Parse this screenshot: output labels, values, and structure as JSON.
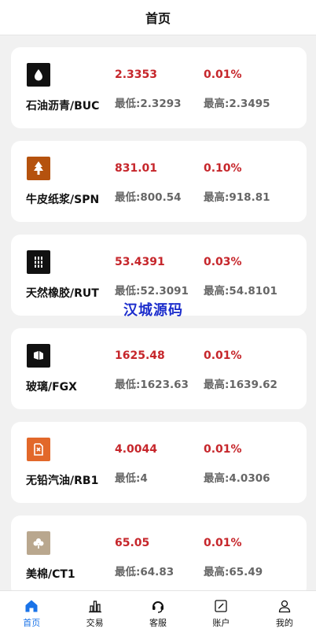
{
  "header": {
    "title": "首页"
  },
  "watermark": "汉城源码",
  "colors": {
    "up": "#c6262b",
    "accent": "#1a73e8"
  },
  "items": [
    {
      "name": "石油沥青/BUC",
      "price": "2.3353",
      "change": "0.01%",
      "low": "最低:2.3293",
      "high": "最高:2.3495",
      "icon": "drop-icon",
      "icon_color": "#111111"
    },
    {
      "name": "牛皮纸浆/SPN",
      "price": "831.01",
      "change": "0.10%",
      "low": "最低:800.54",
      "high": "最高:918.81",
      "icon": "tree-icon",
      "icon_color": "#b5520e"
    },
    {
      "name": "天然橡胶/RUT",
      "price": "53.4391",
      "change": "0.03%",
      "low": "最低:52.3091",
      "high": "最高:54.8101",
      "icon": "rubber-icon",
      "icon_color": "#111111"
    },
    {
      "name": "玻璃/FGX",
      "price": "1625.48",
      "change": "0.01%",
      "low": "最低:1623.63",
      "high": "最高:1639.62",
      "icon": "glass-icon",
      "icon_color": "#111111"
    },
    {
      "name": "无铅汽油/RB1",
      "price": "4.0044",
      "change": "0.01%",
      "low": "最低:4",
      "high": "最高:4.0306",
      "icon": "fuel-can-icon",
      "icon_color": "#e2682a"
    },
    {
      "name": "美棉/CT1",
      "price": "65.05",
      "change": "0.01%",
      "low": "最低:64.83",
      "high": "最高:65.49",
      "icon": "cotton-icon",
      "icon_color": "#b9a78e"
    }
  ],
  "tabs": [
    {
      "label": "首页",
      "icon": "home-icon",
      "active": true
    },
    {
      "label": "交易",
      "icon": "chart-bars-icon",
      "active": false
    },
    {
      "label": "客服",
      "icon": "headset-icon",
      "active": false
    },
    {
      "label": "账户",
      "icon": "edit-box-icon",
      "active": false
    },
    {
      "label": "我的",
      "icon": "user-icon",
      "active": false
    }
  ]
}
